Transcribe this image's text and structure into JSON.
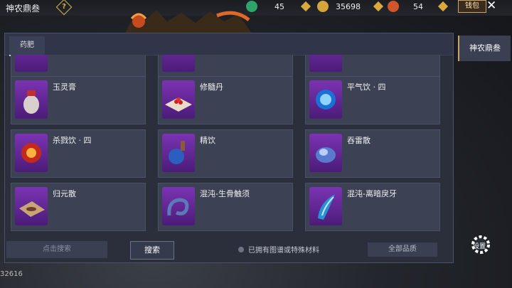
{
  "header": {
    "title": "神农鼎叁",
    "resources": [
      {
        "icon": "jade-icon",
        "value": "45",
        "color": "#2ea36a"
      },
      {
        "icon": "gold-ingot-icon",
        "value": "35698",
        "color": "#d4a63a"
      },
      {
        "icon": "fire-token-icon",
        "value": "54",
        "color": "#d2552a"
      }
    ],
    "wallet_label": "钱包",
    "close_glyph": "✕"
  },
  "panel": {
    "tab": "药肥",
    "items": [
      {
        "name": "玉灵膏",
        "icon": "jar-icon"
      },
      {
        "name": "修髓丹",
        "icon": "red-pills-icon"
      },
      {
        "name": "平气饮 · 四",
        "icon": "blue-orb-icon"
      },
      {
        "name": "杀戮饮 · 四",
        "icon": "fire-orb-icon"
      },
      {
        "name": "精饮",
        "icon": "potion-flask-icon"
      },
      {
        "name": "吞雷散",
        "icon": "lightning-powder-icon"
      },
      {
        "name": "归元散",
        "icon": "powder-paper-icon"
      },
      {
        "name": "混沌-生骨触须",
        "icon": "tentacle-icon"
      },
      {
        "name": "混沌-离暗戾牙",
        "icon": "fang-icon"
      }
    ],
    "search_placeholder": "点击搜索",
    "search_button": "搜索",
    "owned_filter_label": "已拥有图谱或特殊材料",
    "quality_filter": "全部品质"
  },
  "sidebar": {
    "active_tab": "神农鼎叁"
  },
  "settings_label": "设置",
  "coordinate_text": "32616"
}
